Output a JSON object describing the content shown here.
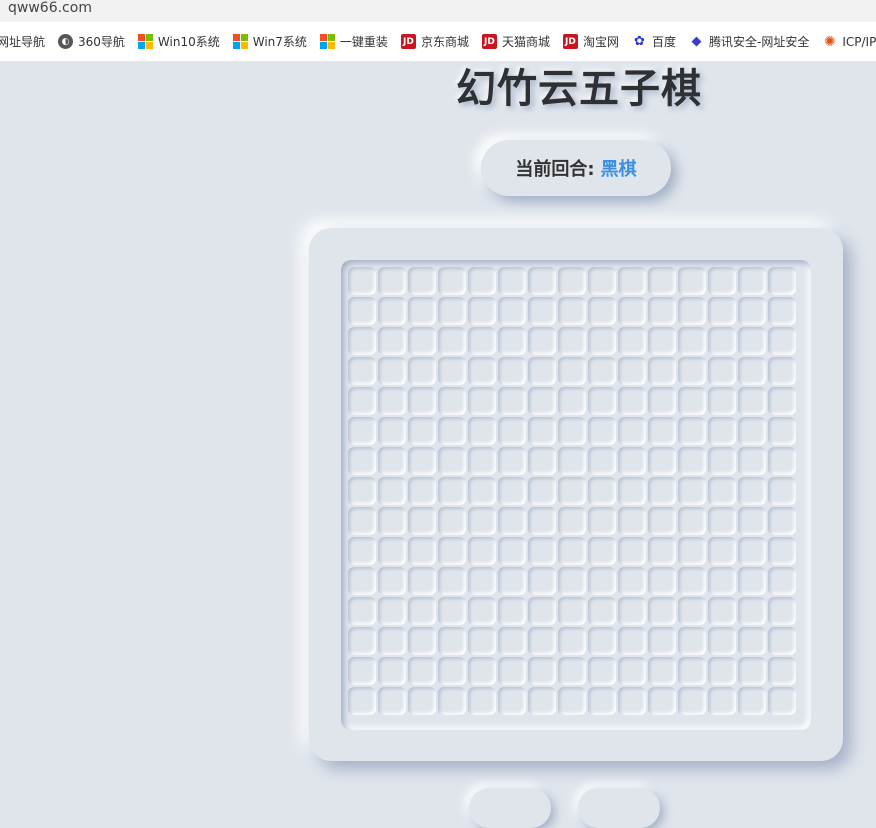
{
  "browser": {
    "url": "qww66.com",
    "bookmarks": [
      {
        "label": "网址导航",
        "icon": "none"
      },
      {
        "label": "360导航",
        "icon": "globe-icon"
      },
      {
        "label": "Win10系统",
        "icon": "windows-icon"
      },
      {
        "label": "Win7系统",
        "icon": "windows-icon"
      },
      {
        "label": "一键重装",
        "icon": "windows-icon"
      },
      {
        "label": "京东商城",
        "icon": "jd-icon",
        "icon_text": "JD"
      },
      {
        "label": "天猫商城",
        "icon": "jd-icon",
        "icon_text": "JD"
      },
      {
        "label": "淘宝网",
        "icon": "jd-icon",
        "icon_text": "JD"
      },
      {
        "label": "百度",
        "icon": "baidu-paw-icon"
      },
      {
        "label": "腾讯安全-网址安全",
        "icon": "shield-icon"
      },
      {
        "label": "ICP/IP地",
        "icon": "icp-icon"
      }
    ]
  },
  "game": {
    "title": "幻竹云五子棋",
    "turn_label": "当前回合:",
    "turn_value": "黑棋",
    "board_size": 15,
    "colors": {
      "background": "#e0e5ec",
      "turn_accent": "#3a8fe0",
      "title": "#2f3033"
    }
  }
}
